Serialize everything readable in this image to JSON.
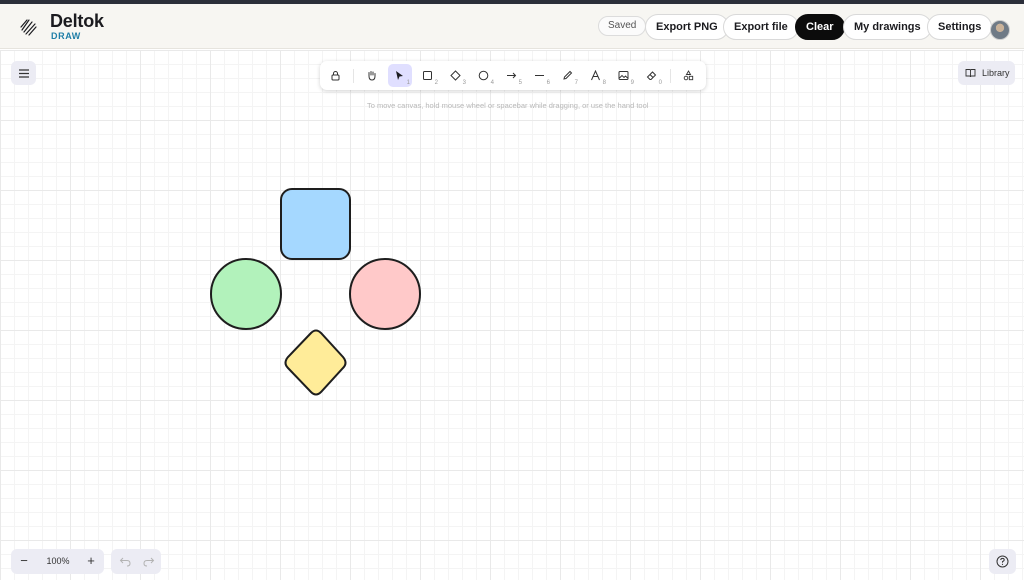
{
  "header": {
    "brand_name": "Deltok",
    "brand_sub": "DRAW",
    "status": "Saved",
    "buttons": {
      "export_png": "Export PNG",
      "export_file": "Export file",
      "clear": "Clear",
      "my_drawings": "My drawings",
      "settings": "Settings"
    }
  },
  "toolbar": {
    "tools": [
      {
        "name": "lock",
        "shortcut": ""
      },
      {
        "name": "hand",
        "shortcut": ""
      },
      {
        "name": "selection",
        "shortcut": "1",
        "active": true
      },
      {
        "name": "rectangle",
        "shortcut": "2"
      },
      {
        "name": "diamond",
        "shortcut": "3"
      },
      {
        "name": "ellipse",
        "shortcut": "4"
      },
      {
        "name": "arrow",
        "shortcut": "5"
      },
      {
        "name": "line",
        "shortcut": "6"
      },
      {
        "name": "draw",
        "shortcut": "7"
      },
      {
        "name": "text",
        "shortcut": "8"
      },
      {
        "name": "image",
        "shortcut": "9"
      },
      {
        "name": "eraser",
        "shortcut": "0"
      },
      {
        "name": "more-shapes",
        "shortcut": ""
      }
    ],
    "hint": "To move canvas, hold mouse wheel or spacebar while dragging, or use the hand tool"
  },
  "library": {
    "label": "Library"
  },
  "zoom": {
    "value": "100%",
    "minus": "−",
    "plus": "+"
  },
  "canvas_shapes": [
    {
      "kind": "rounded-square",
      "fill": "#a5d8ff"
    },
    {
      "kind": "circle",
      "fill": "#b2f2bb"
    },
    {
      "kind": "circle",
      "fill": "#ffc9c9"
    },
    {
      "kind": "diamond",
      "fill": "#ffec99"
    }
  ],
  "colors": {
    "accent": "#e0dfff",
    "brand_sub": "#1f7ea7",
    "stroke": "#1e1e1e"
  }
}
